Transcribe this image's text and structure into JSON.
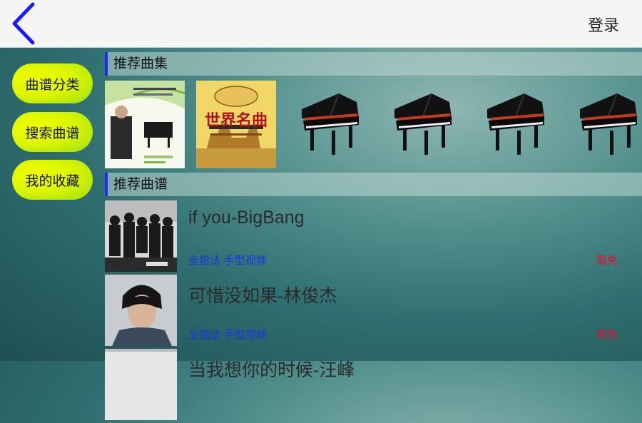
{
  "header": {
    "login_label": "登录"
  },
  "sidebar": {
    "items": [
      {
        "label": "曲谱分类"
      },
      {
        "label": "搜索曲谱"
      },
      {
        "label": "我的收藏"
      }
    ]
  },
  "sections": {
    "collections_title": "推荐曲集",
    "scores_title": "推荐曲谱"
  },
  "collections": {
    "book2_text": "世界名曲"
  },
  "songs": [
    {
      "title": "if you-BigBang",
      "tags": "全指法 手型视频",
      "badge": "限免"
    },
    {
      "title": "可惜没如果-林俊杰",
      "tags": "全指法 手型视频",
      "badge": "限免"
    },
    {
      "title": "当我想你的时候-汪峰",
      "tags": "",
      "badge": ""
    }
  ],
  "colors": {
    "accent": "#1a33e6",
    "badge": "#e0102a",
    "pill": "#e8f800"
  }
}
